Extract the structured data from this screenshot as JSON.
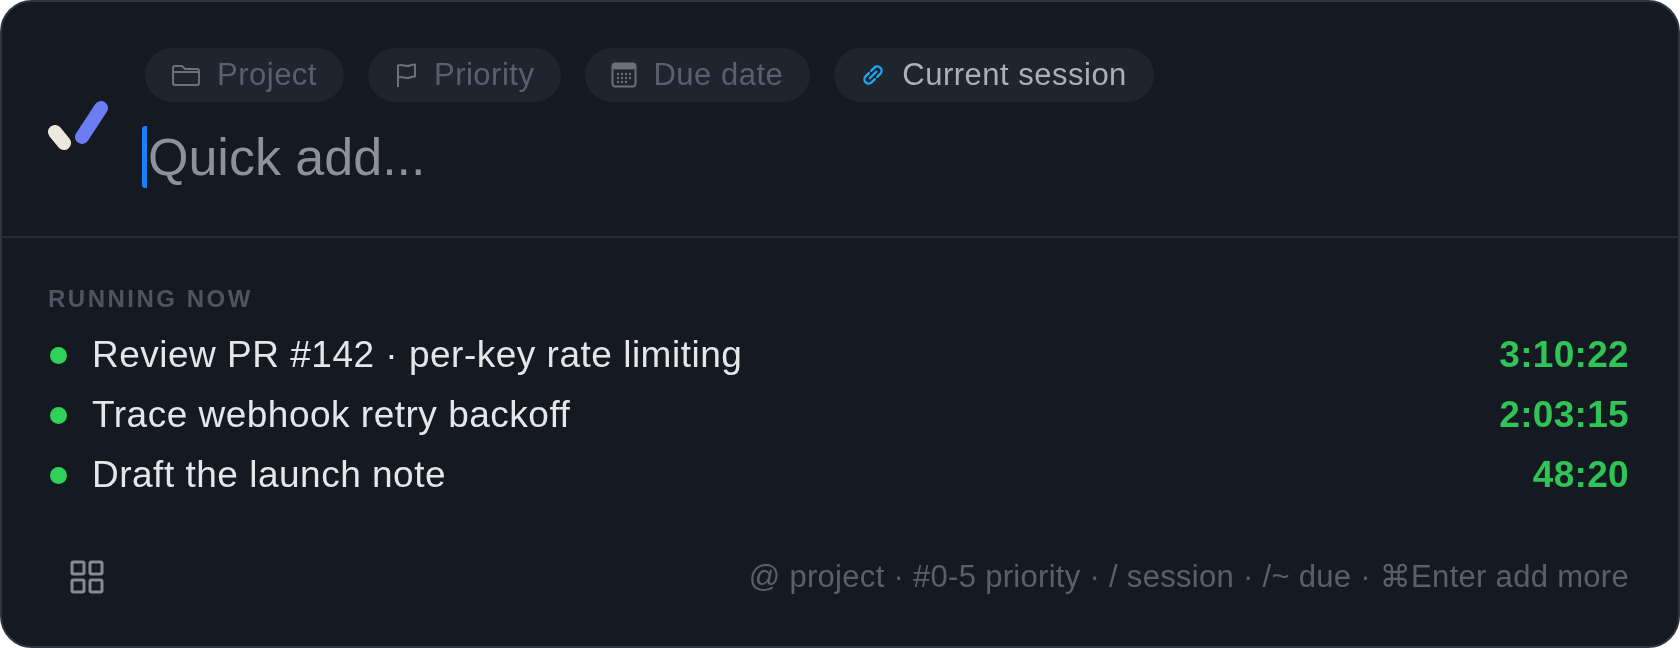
{
  "chips": [
    {
      "kind": "project",
      "label": "Project",
      "selected": false
    },
    {
      "kind": "priority",
      "label": "Priority",
      "selected": false
    },
    {
      "kind": "due",
      "label": "Due date",
      "selected": false
    },
    {
      "kind": "session",
      "label": "Current session",
      "selected": true
    }
  ],
  "quick_add": {
    "placeholder": "Quick add..."
  },
  "running": {
    "heading": "RUNNING NOW",
    "tasks": [
      {
        "title": "Review PR #142 · per-key rate limiting",
        "elapsed": "3:10:22"
      },
      {
        "title": "Trace webhook retry backoff",
        "elapsed": "2:03:15"
      },
      {
        "title": "Draft the launch note",
        "elapsed": "48:20"
      }
    ]
  },
  "footer": {
    "hint": "@ project · #0-5 priority · / session · /~ due · ⌘Enter add more"
  }
}
